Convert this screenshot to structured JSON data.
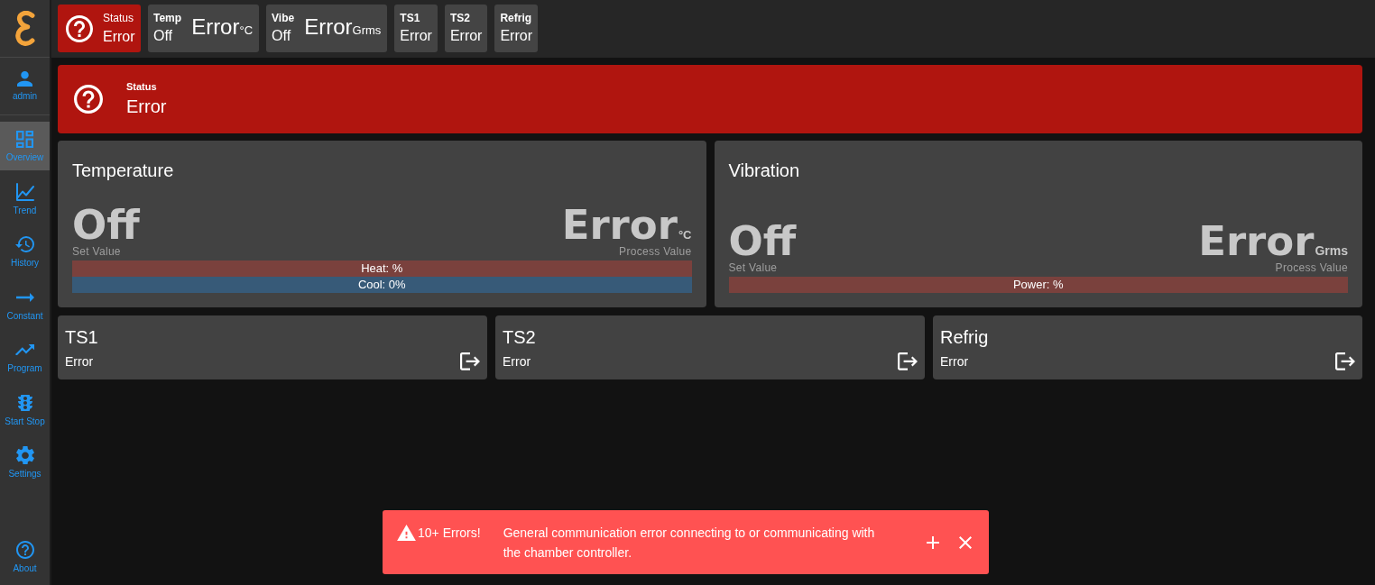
{
  "sidebar": {
    "user": {
      "label": "admin"
    },
    "items": [
      {
        "label": "Overview",
        "selected": true
      },
      {
        "label": "Trend",
        "selected": false
      },
      {
        "label": "History",
        "selected": false
      },
      {
        "label": "Constant",
        "selected": false
      },
      {
        "label": "Program",
        "selected": false
      },
      {
        "label": "Start Stop",
        "selected": false
      },
      {
        "label": "Settings",
        "selected": false
      }
    ],
    "footer_item": {
      "label": "About"
    }
  },
  "top_bar": {
    "tiles": [
      {
        "kind": "status",
        "label": "Status",
        "value": "Error"
      },
      {
        "kind": "reading",
        "label": "Temp",
        "set_value": "Off",
        "process_value": "Error",
        "unit": "°C"
      },
      {
        "kind": "reading",
        "label": "Vibe",
        "set_value": "Off",
        "process_value": "Error",
        "unit": "Grms"
      },
      {
        "kind": "sensor",
        "label": "TS1",
        "value": "Error"
      },
      {
        "kind": "sensor",
        "label": "TS2",
        "value": "Error"
      },
      {
        "kind": "sensor",
        "label": "Refrig",
        "value": "Error"
      }
    ]
  },
  "status_banner": {
    "label": "Status",
    "value": "Error"
  },
  "control_cards": [
    {
      "title": "Temperature",
      "set_value": "Off",
      "set_value_label": "Set Value",
      "process_value": "Error",
      "unit": "°C",
      "process_value_label": "Process Value",
      "bars": [
        {
          "kind": "heat",
          "label": "Heat: %"
        },
        {
          "kind": "cool",
          "label": "Cool: 0%"
        }
      ]
    },
    {
      "title": "Vibration",
      "set_value": "Off",
      "set_value_label": "Set Value",
      "process_value": "Error",
      "unit": "Grms",
      "process_value_label": "Process Value",
      "bars": [
        {
          "kind": "power",
          "label": "Power: %"
        }
      ]
    }
  ],
  "sensor_cards": [
    {
      "title": "TS1",
      "value": "Error"
    },
    {
      "title": "TS2",
      "value": "Error"
    },
    {
      "title": "Refrig",
      "value": "Error"
    }
  ],
  "toast": {
    "count": "10+ Errors!",
    "message": "General communication error connecting to or communicating with the chamber controller."
  }
}
